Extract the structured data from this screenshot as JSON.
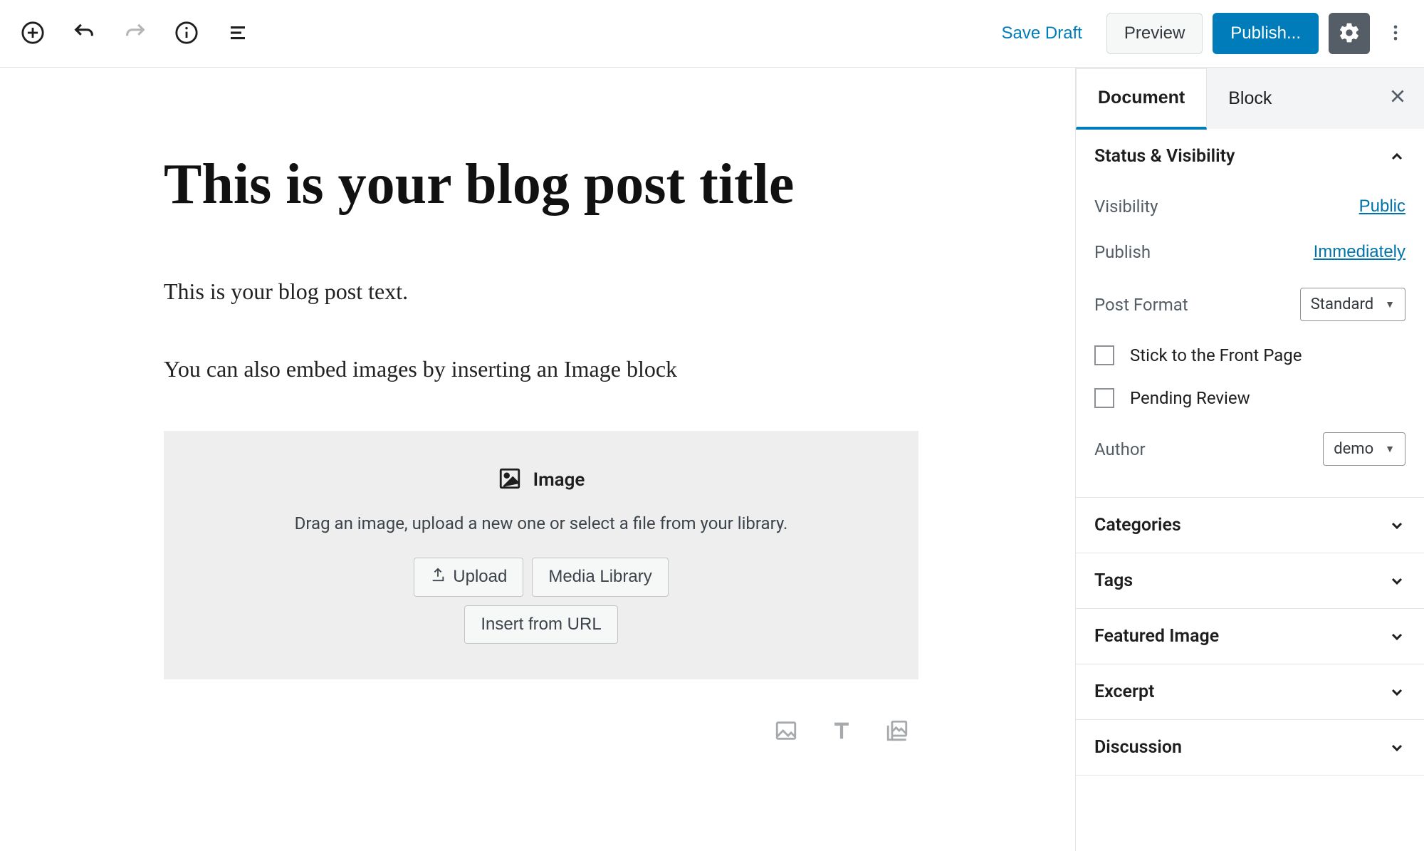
{
  "toolbar": {
    "save_draft": "Save Draft",
    "preview": "Preview",
    "publish": "Publish..."
  },
  "editor": {
    "post_title": "This is your blog post title",
    "paragraphs": [
      "This is your blog post text.",
      "You can also embed images by inserting an Image block"
    ],
    "image_block": {
      "label": "Image",
      "description": "Drag an image, upload a new one or select a file from your library.",
      "upload": "Upload",
      "media_library": "Media Library",
      "insert_url": "Insert from URL"
    }
  },
  "sidebar": {
    "tabs": {
      "document": "Document",
      "block": "Block"
    },
    "status_visibility": {
      "title": "Status & Visibility",
      "visibility_label": "Visibility",
      "visibility_value": "Public",
      "publish_label": "Publish",
      "publish_value": "Immediately",
      "post_format_label": "Post Format",
      "post_format_value": "Standard",
      "stick_front_page": "Stick to the Front Page",
      "pending_review": "Pending Review",
      "author_label": "Author",
      "author_value": "demo"
    },
    "panels": {
      "categories": "Categories",
      "tags": "Tags",
      "featured_image": "Featured Image",
      "excerpt": "Excerpt",
      "discussion": "Discussion"
    }
  }
}
